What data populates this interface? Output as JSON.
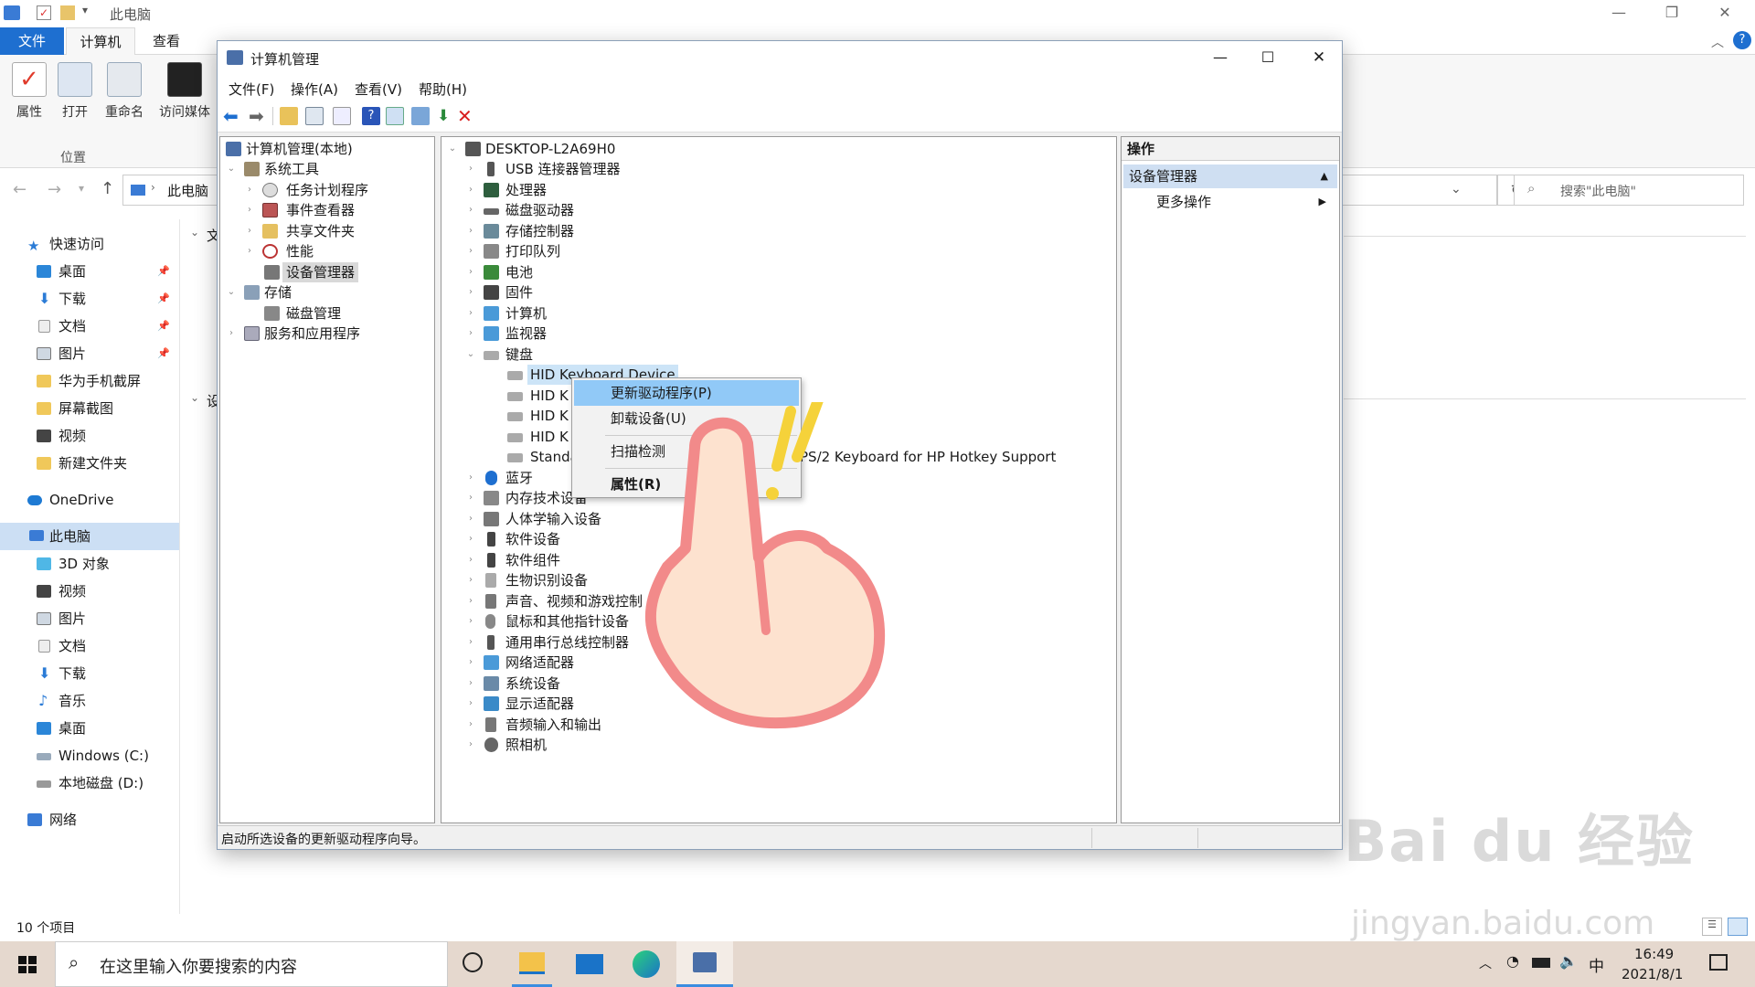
{
  "explorer": {
    "title": "此电脑",
    "tabs": [
      {
        "label": "文件"
      },
      {
        "label": "计算机"
      },
      {
        "label": "查看"
      }
    ],
    "ribbon": {
      "properties": "属性",
      "open": "打开",
      "rename": "重命名",
      "access_media": "访问媒体",
      "group_location": "位置"
    },
    "address": {
      "location": "此电脑",
      "search_placeholder": "搜索\"此电脑\""
    },
    "nav": [
      {
        "label": "快速访问"
      },
      {
        "label": "桌面"
      },
      {
        "label": "下载"
      },
      {
        "label": "文档"
      },
      {
        "label": "图片"
      },
      {
        "label": "华为手机截屏"
      },
      {
        "label": "屏幕截图"
      },
      {
        "label": "视频"
      },
      {
        "label": "新建文件夹"
      },
      {
        "label": "OneDrive"
      },
      {
        "label": "此电脑"
      },
      {
        "label": "3D 对象"
      },
      {
        "label": "视频"
      },
      {
        "label": "图片"
      },
      {
        "label": "文档"
      },
      {
        "label": "下载"
      },
      {
        "label": "音乐"
      },
      {
        "label": "桌面"
      },
      {
        "label": "Windows (C:)"
      },
      {
        "label": "本地磁盘 (D:)"
      },
      {
        "label": "网络"
      }
    ],
    "section_partial": [
      "文",
      "设"
    ],
    "status": "10 个项目"
  },
  "mmc": {
    "title": "计算机管理",
    "menu": [
      "文件(F)",
      "操作(A)",
      "查看(V)",
      "帮助(H)"
    ],
    "left_tree": [
      {
        "label": "计算机管理(本地)"
      },
      {
        "label": "系统工具"
      },
      {
        "label": "任务计划程序"
      },
      {
        "label": "事件查看器"
      },
      {
        "label": "共享文件夹"
      },
      {
        "label": "性能"
      },
      {
        "label": "设备管理器"
      },
      {
        "label": "存储"
      },
      {
        "label": "磁盘管理"
      },
      {
        "label": "服务和应用程序"
      }
    ],
    "devices": [
      {
        "label": "DESKTOP-L2A69H0"
      },
      {
        "label": "USB 连接器管理器"
      },
      {
        "label": "处理器"
      },
      {
        "label": "磁盘驱动器"
      },
      {
        "label": "存储控制器"
      },
      {
        "label": "打印队列"
      },
      {
        "label": "电池"
      },
      {
        "label": "固件"
      },
      {
        "label": "计算机"
      },
      {
        "label": "监视器"
      },
      {
        "label": "键盘"
      },
      {
        "label": "HID Keyboard Device"
      },
      {
        "label": "HID K"
      },
      {
        "label": "HID K"
      },
      {
        "label": "HID K"
      },
      {
        "label": "Standa"
      },
      {
        "label": "蓝牙"
      },
      {
        "label": "内存技术设备"
      },
      {
        "label": "人体学输入设备"
      },
      {
        "label": "软件设备"
      },
      {
        "label": "软件组件"
      },
      {
        "label": "生物识别设备"
      },
      {
        "label": "声音、视频和游戏控制"
      },
      {
        "label": "鼠标和其他指针设备"
      },
      {
        "label": "通用串行总线控制器"
      },
      {
        "label": "网络适配器"
      },
      {
        "label": "系统设备"
      },
      {
        "label": "显示适配器"
      },
      {
        "label": "音频输入和输出"
      },
      {
        "label": "照相机"
      }
    ],
    "standard_kb_tail": "PS/2 Keyboard for HP Hotkey Support",
    "actions": {
      "header": "操作",
      "section": "设备管理器",
      "more": "更多操作"
    },
    "status": "启动所选设备的更新驱动程序向导。",
    "context_menu": [
      "更新驱动程序(P)",
      "卸载设备(U)",
      "扫描检测",
      "属性(R)"
    ]
  },
  "taskbar": {
    "search_placeholder": "在这里输入你要搜索的内容",
    "time": "16:49",
    "date": "2021/8/1",
    "ime": "中"
  },
  "watermark": {
    "brand": "Bai du 经验",
    "url": "jingyan.baidu.com"
  }
}
